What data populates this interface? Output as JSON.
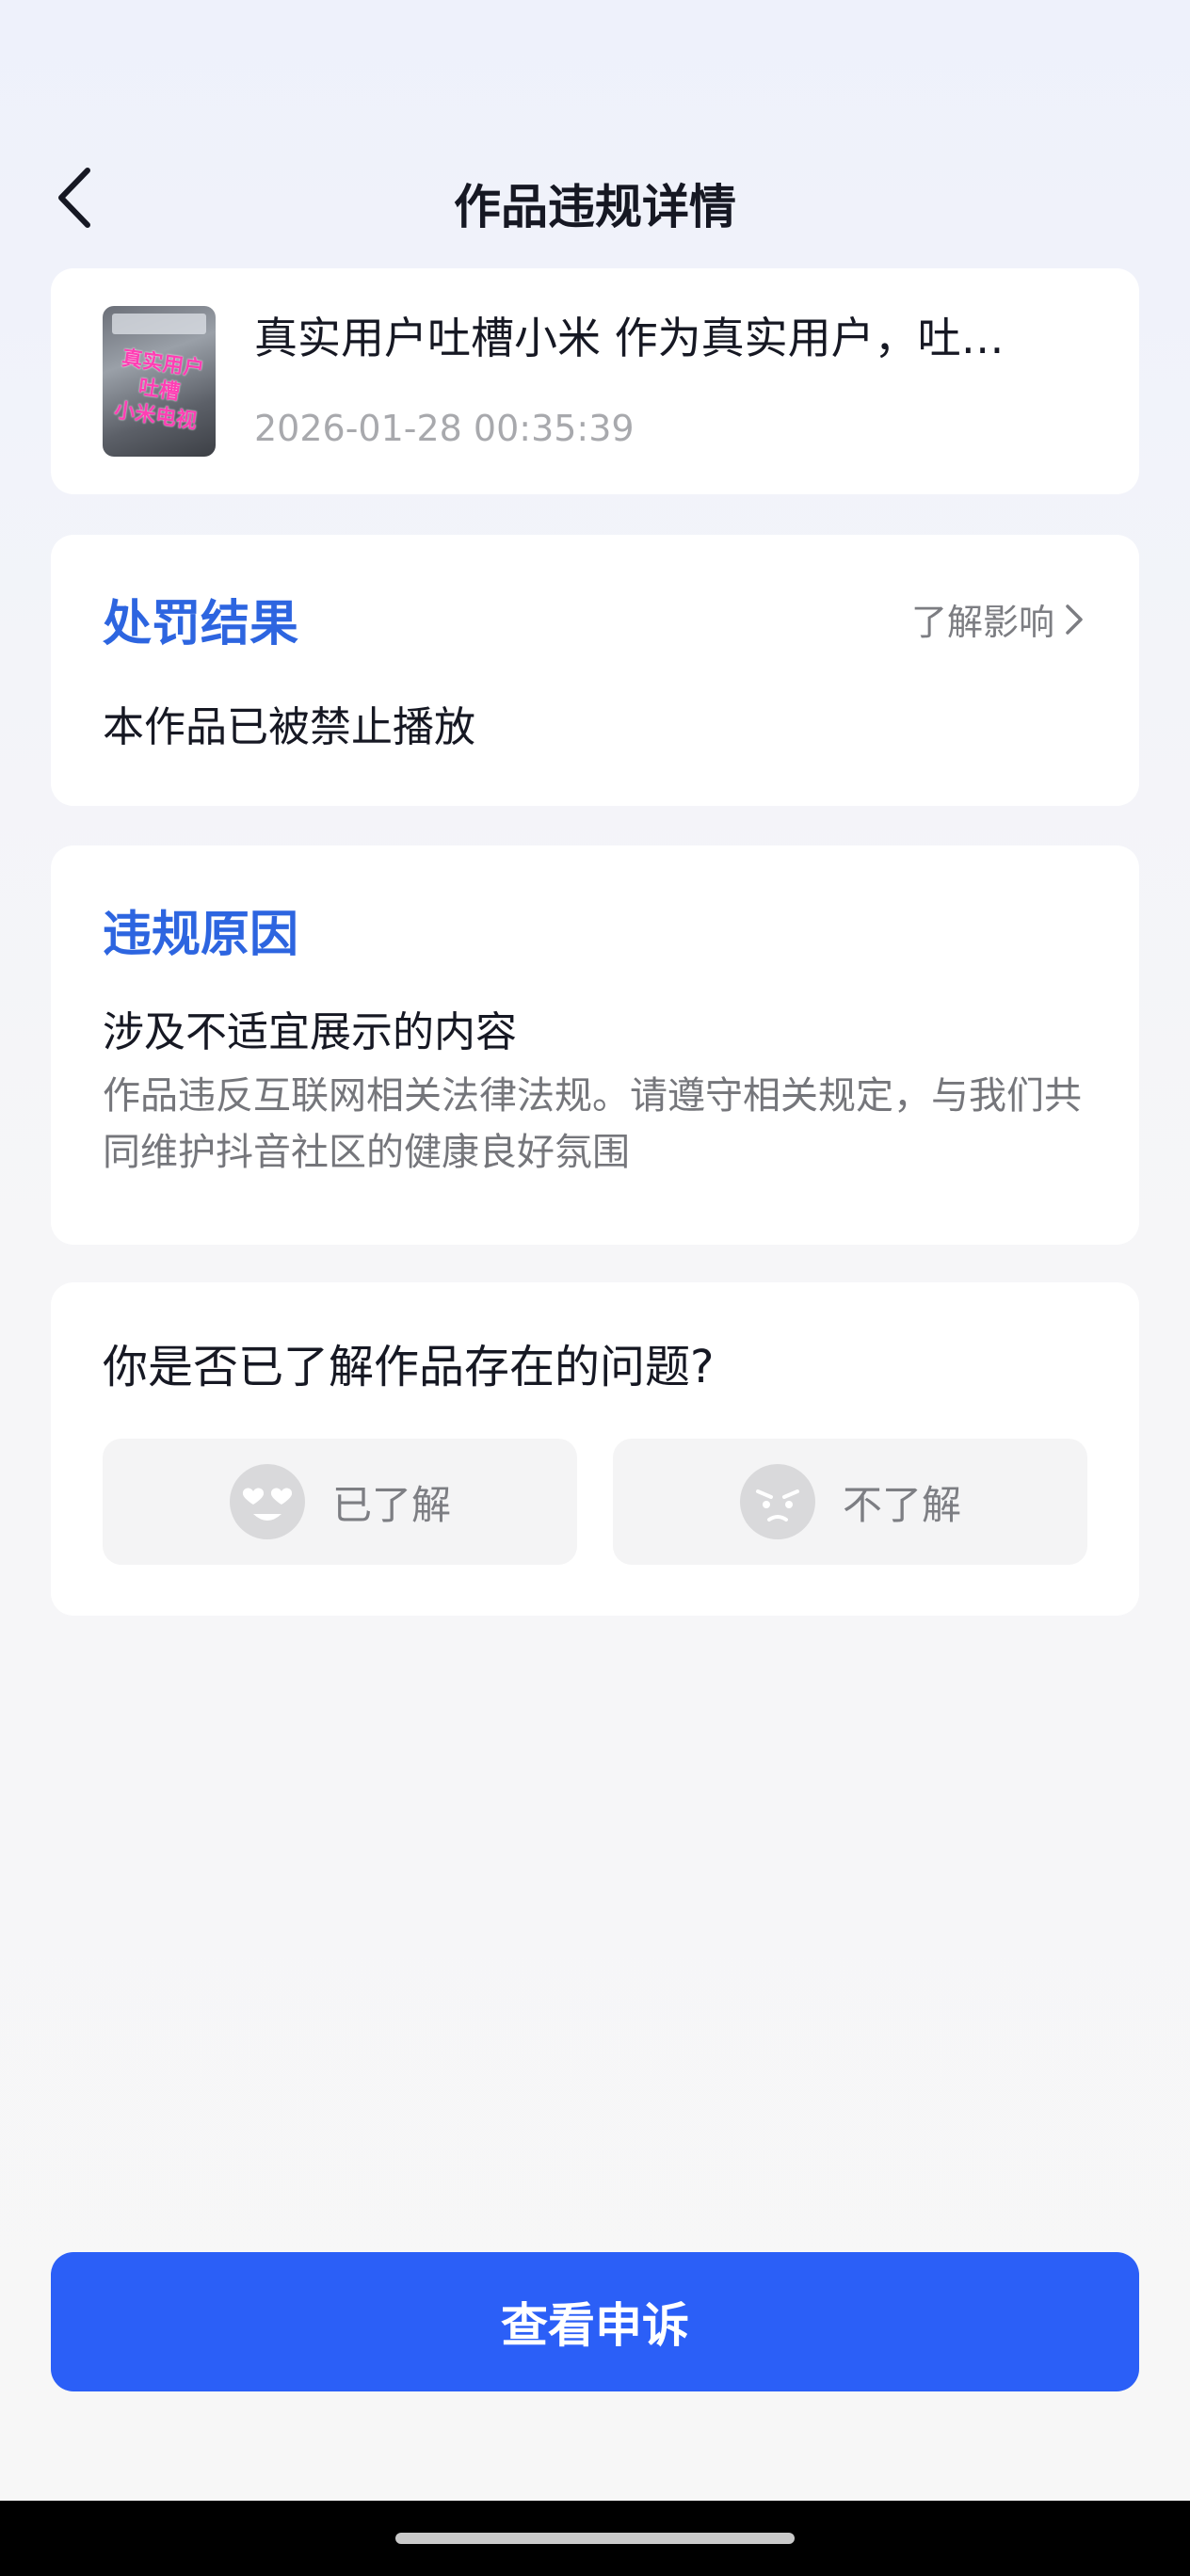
{
  "header": {
    "title": "作品违规详情",
    "back_icon": "chevron-left-icon"
  },
  "video": {
    "thumbnail_text": "真实用户\n吐槽\n小米电视",
    "title": "真实用户吐槽小米 作为真实用户，吐…",
    "timestamp": "2026-01-28 00:35:39"
  },
  "penalty": {
    "heading": "处罚结果",
    "learn_more": "了解影响",
    "result": "本作品已被禁止播放"
  },
  "reason": {
    "heading": "违规原因",
    "subtitle": "涉及不适宜展示的内容",
    "description": "作品违反互联网相关法律法规。请遵守相关规定，与我们共同维护抖音社区的健康良好氛围"
  },
  "feedback": {
    "question": "你是否已了解作品存在的问题?",
    "options": [
      {
        "label": "已了解",
        "icon": "heart-eyes-face-icon"
      },
      {
        "label": "不了解",
        "icon": "angry-face-icon"
      }
    ]
  },
  "appeal_button": "查看申诉",
  "colors": {
    "accent_blue": "#2d65e0",
    "button_blue": "#2b5ff7",
    "text_primary": "#161823",
    "text_secondary": "#75767b"
  }
}
